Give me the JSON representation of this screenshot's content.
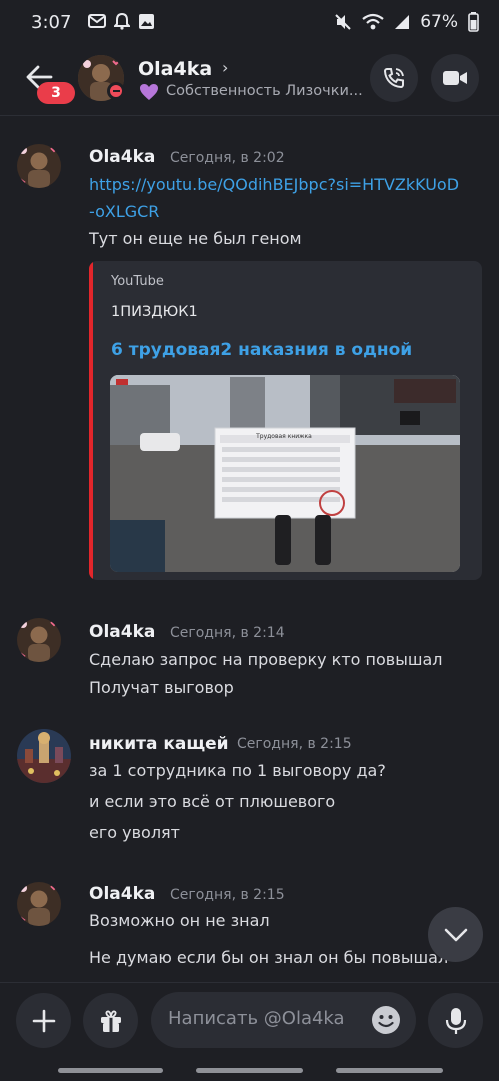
{
  "status_bar": {
    "time": "3:07",
    "battery": "67%"
  },
  "header": {
    "unread_count": "3",
    "name": "Ola4ka",
    "status_text": "Собственность Лизочки..."
  },
  "messages": [
    {
      "author": "Ola4ka",
      "timestamp": "Сегодня, в 2:02",
      "link_line1": "https://youtu.be/QOdihBEJbpc?si=HTVZkKUoD",
      "link_line2": "-oXLGCR",
      "text": "Тут он еще не был геном",
      "embed": {
        "provider": "YouTube",
        "author": "1ПИЗДЮК1",
        "title": "6 трудовая2 наказния в одной",
        "thumb_panel_title": "Трудовая книжка"
      }
    },
    {
      "author": "Ola4ka",
      "timestamp": "Сегодня, в 2:14",
      "lines": [
        "Сделаю запрос на проверку кто повышал",
        "Получат выговор"
      ]
    },
    {
      "author": "никита кащей",
      "timestamp": "Сегодня, в 2:15",
      "lines": [
        "за 1 сотрудника по 1 выговору да?",
        "и если это всё от плюшевого",
        "его уволят"
      ]
    },
    {
      "author": "Ola4ka",
      "timestamp": "Сегодня, в 2:15",
      "lines": [
        "Возможно он не знал",
        "Не думаю если бы он знал он бы повышал"
      ]
    }
  ],
  "composer": {
    "placeholder": "Написать @Ola4ka"
  },
  "icons": {
    "back": "arrow-left-icon",
    "call": "phone-call-icon",
    "video": "video-camera-icon",
    "scroll": "chevron-down-icon",
    "add": "plus-icon",
    "gift": "gift-icon",
    "emoji": "emoji-icon",
    "mic": "microphone-icon"
  },
  "colors": {
    "background": "#1e1f24",
    "link": "#3ea1e6",
    "badge": "#ea3d4a",
    "embed_accent": "#e2262b"
  }
}
